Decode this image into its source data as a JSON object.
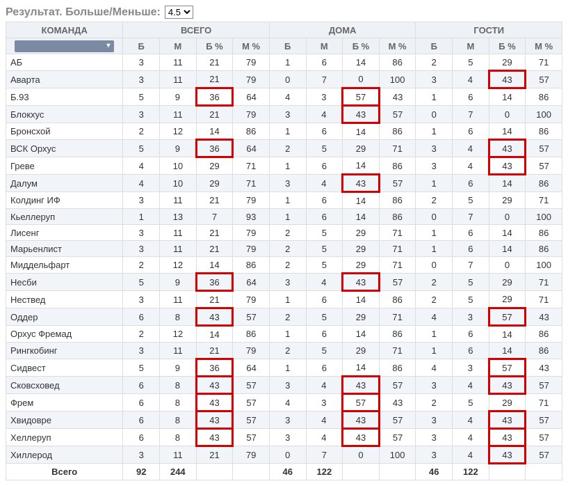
{
  "header": {
    "title": "Результат. Больше/Меньше:",
    "select_value": "4.5"
  },
  "columns": {
    "team": "КОМАНДА",
    "total": "ВСЕГО",
    "home": "ДОМА",
    "away": "ГОСТИ",
    "sub": [
      "Б",
      "М",
      "Б %",
      "М %"
    ]
  },
  "total_label": "Всего",
  "totals": {
    "total": [
      "92",
      "244",
      "",
      ""
    ],
    "home": [
      "46",
      "122",
      "",
      ""
    ],
    "away": [
      "46",
      "122",
      "",
      ""
    ]
  },
  "rows": [
    {
      "team": "АБ",
      "total": [
        "3",
        "11",
        "21",
        "79"
      ],
      "home": [
        "1",
        "6",
        "14",
        "86"
      ],
      "away": [
        "2",
        "5",
        "29",
        "71"
      ],
      "hl": {}
    },
    {
      "team": "Аварта",
      "total": [
        "3",
        "11",
        "21",
        "79"
      ],
      "home": [
        "0",
        "7",
        "0",
        "100"
      ],
      "away": [
        "3",
        "4",
        "43",
        "57"
      ],
      "hl": {
        "a2": 1
      }
    },
    {
      "team": "Б.93",
      "total": [
        "5",
        "9",
        "36",
        "64"
      ],
      "home": [
        "4",
        "3",
        "57",
        "43"
      ],
      "away": [
        "1",
        "6",
        "14",
        "86"
      ],
      "hl": {
        "t2": 1,
        "h2": 1
      }
    },
    {
      "team": "Блокхус",
      "total": [
        "3",
        "11",
        "21",
        "79"
      ],
      "home": [
        "3",
        "4",
        "43",
        "57"
      ],
      "away": [
        "0",
        "7",
        "0",
        "100"
      ],
      "hl": {
        "h2": 1
      }
    },
    {
      "team": "Бронсхой",
      "total": [
        "2",
        "12",
        "14",
        "86"
      ],
      "home": [
        "1",
        "6",
        "14",
        "86"
      ],
      "away": [
        "1",
        "6",
        "14",
        "86"
      ],
      "hl": {}
    },
    {
      "team": "ВСК Орхус",
      "total": [
        "5",
        "9",
        "36",
        "64"
      ],
      "home": [
        "2",
        "5",
        "29",
        "71"
      ],
      "away": [
        "3",
        "4",
        "43",
        "57"
      ],
      "hl": {
        "t2": 1,
        "a2": 1
      }
    },
    {
      "team": "Греве",
      "total": [
        "4",
        "10",
        "29",
        "71"
      ],
      "home": [
        "1",
        "6",
        "14",
        "86"
      ],
      "away": [
        "3",
        "4",
        "43",
        "57"
      ],
      "hl": {
        "a2": 1
      }
    },
    {
      "team": "Далум",
      "total": [
        "4",
        "10",
        "29",
        "71"
      ],
      "home": [
        "3",
        "4",
        "43",
        "57"
      ],
      "away": [
        "1",
        "6",
        "14",
        "86"
      ],
      "hl": {
        "h2": 1
      }
    },
    {
      "team": "Колдинг ИФ",
      "total": [
        "3",
        "11",
        "21",
        "79"
      ],
      "home": [
        "1",
        "6",
        "14",
        "86"
      ],
      "away": [
        "2",
        "5",
        "29",
        "71"
      ],
      "hl": {}
    },
    {
      "team": "Кьеллеруп",
      "total": [
        "1",
        "13",
        "7",
        "93"
      ],
      "home": [
        "1",
        "6",
        "14",
        "86"
      ],
      "away": [
        "0",
        "7",
        "0",
        "100"
      ],
      "hl": {}
    },
    {
      "team": "Лисенг",
      "total": [
        "3",
        "11",
        "21",
        "79"
      ],
      "home": [
        "2",
        "5",
        "29",
        "71"
      ],
      "away": [
        "1",
        "6",
        "14",
        "86"
      ],
      "hl": {}
    },
    {
      "team": "Марьенлист",
      "total": [
        "3",
        "11",
        "21",
        "79"
      ],
      "home": [
        "2",
        "5",
        "29",
        "71"
      ],
      "away": [
        "1",
        "6",
        "14",
        "86"
      ],
      "hl": {}
    },
    {
      "team": "Миддельфарт",
      "total": [
        "2",
        "12",
        "14",
        "86"
      ],
      "home": [
        "2",
        "5",
        "29",
        "71"
      ],
      "away": [
        "0",
        "7",
        "0",
        "100"
      ],
      "hl": {}
    },
    {
      "team": "Несби",
      "total": [
        "5",
        "9",
        "36",
        "64"
      ],
      "home": [
        "3",
        "4",
        "43",
        "57"
      ],
      "away": [
        "2",
        "5",
        "29",
        "71"
      ],
      "hl": {
        "t2": 1,
        "h2": 1
      }
    },
    {
      "team": "Нествед",
      "total": [
        "3",
        "11",
        "21",
        "79"
      ],
      "home": [
        "1",
        "6",
        "14",
        "86"
      ],
      "away": [
        "2",
        "5",
        "29",
        "71"
      ],
      "hl": {}
    },
    {
      "team": "Оддер",
      "total": [
        "6",
        "8",
        "43",
        "57"
      ],
      "home": [
        "2",
        "5",
        "29",
        "71"
      ],
      "away": [
        "4",
        "3",
        "57",
        "43"
      ],
      "hl": {
        "t2": 1,
        "a2": 1
      }
    },
    {
      "team": "Орхус Фремад",
      "total": [
        "2",
        "12",
        "14",
        "86"
      ],
      "home": [
        "1",
        "6",
        "14",
        "86"
      ],
      "away": [
        "1",
        "6",
        "14",
        "86"
      ],
      "hl": {}
    },
    {
      "team": "Рингкобинг",
      "total": [
        "3",
        "11",
        "21",
        "79"
      ],
      "home": [
        "2",
        "5",
        "29",
        "71"
      ],
      "away": [
        "1",
        "6",
        "14",
        "86"
      ],
      "hl": {}
    },
    {
      "team": "Сидвест",
      "total": [
        "5",
        "9",
        "36",
        "64"
      ],
      "home": [
        "1",
        "6",
        "14",
        "86"
      ],
      "away": [
        "4",
        "3",
        "57",
        "43"
      ],
      "hl": {
        "t2": 1,
        "a2": 1
      }
    },
    {
      "team": "Сковсховед",
      "total": [
        "6",
        "8",
        "43",
        "57"
      ],
      "home": [
        "3",
        "4",
        "43",
        "57"
      ],
      "away": [
        "3",
        "4",
        "43",
        "57"
      ],
      "hl": {
        "t2": 1,
        "h2": 1,
        "a2": 1
      }
    },
    {
      "team": "Фрем",
      "total": [
        "6",
        "8",
        "43",
        "57"
      ],
      "home": [
        "4",
        "3",
        "57",
        "43"
      ],
      "away": [
        "2",
        "5",
        "29",
        "71"
      ],
      "hl": {
        "t2": 1,
        "h2": 1
      }
    },
    {
      "team": "Хвидовре",
      "total": [
        "6",
        "8",
        "43",
        "57"
      ],
      "home": [
        "3",
        "4",
        "43",
        "57"
      ],
      "away": [
        "3",
        "4",
        "43",
        "57"
      ],
      "hl": {
        "t2": 1,
        "h2": 1,
        "a2": 1
      }
    },
    {
      "team": "Хеллеруп",
      "total": [
        "6",
        "8",
        "43",
        "57"
      ],
      "home": [
        "3",
        "4",
        "43",
        "57"
      ],
      "away": [
        "3",
        "4",
        "43",
        "57"
      ],
      "hl": {
        "t2": 1,
        "h2": 1,
        "a2": 1
      }
    },
    {
      "team": "Хиллерод",
      "total": [
        "3",
        "11",
        "21",
        "79"
      ],
      "home": [
        "0",
        "7",
        "0",
        "100"
      ],
      "away": [
        "3",
        "4",
        "43",
        "57"
      ],
      "hl": {
        "a2": 1
      }
    }
  ]
}
